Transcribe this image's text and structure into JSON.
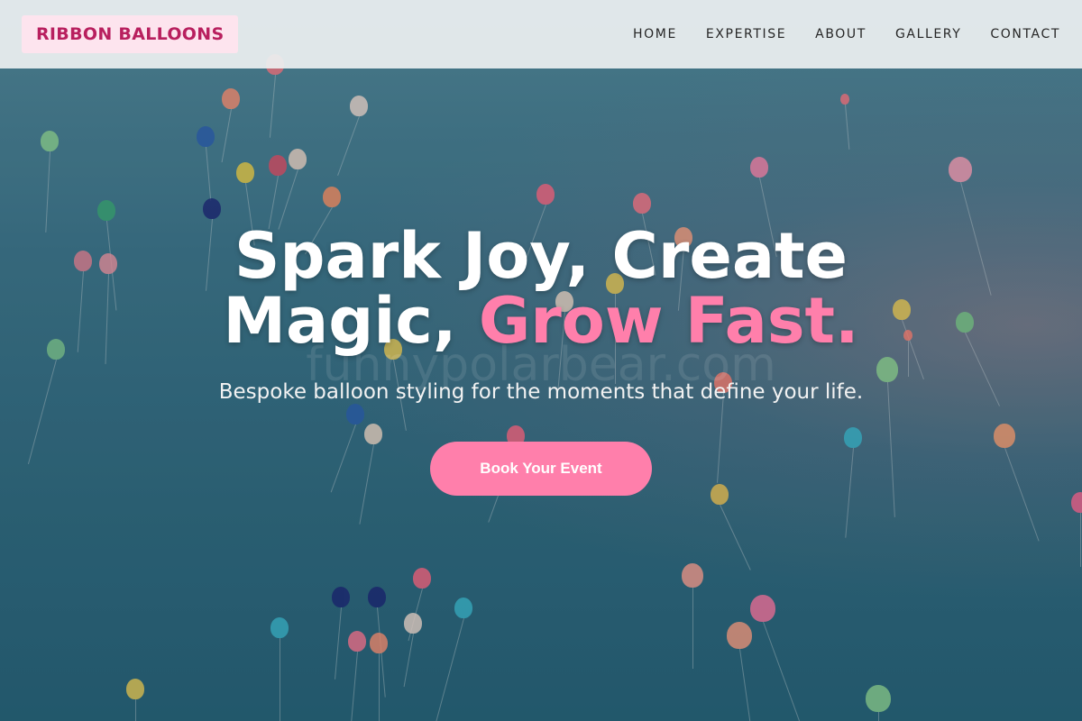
{
  "brand": {
    "logo_text": "RIBBON BALLOONS"
  },
  "nav": {
    "items": [
      {
        "label": "HOME"
      },
      {
        "label": "EXPERTISE"
      },
      {
        "label": "ABOUT"
      },
      {
        "label": "GALLERY"
      },
      {
        "label": "CONTACT"
      }
    ]
  },
  "hero": {
    "headline_line1": "Spark Joy, Create",
    "headline_line2_start": "Magic, ",
    "headline_accent": "Grow Fast.",
    "subheadline": "Bespoke balloon styling for the moments that define your life.",
    "cta_label": "Book Your Event",
    "watermark": "funnypolarbear.com"
  },
  "colors": {
    "brand_accent": "#b81f5e",
    "cta_pink": "#ff7fab",
    "logo_bg": "#fde4ee"
  }
}
